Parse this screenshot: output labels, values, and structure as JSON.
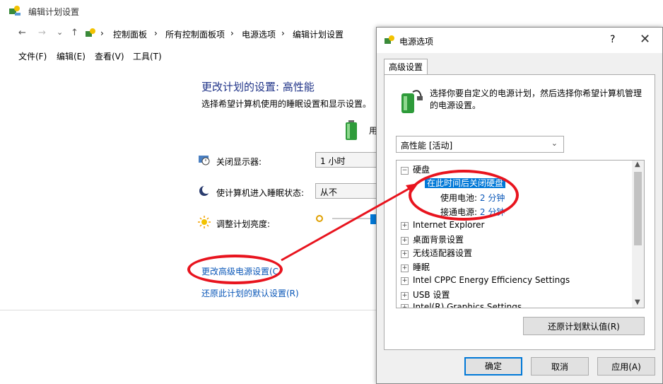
{
  "window": {
    "title": "编辑计划设置",
    "nav": {
      "back": "←",
      "forward": "→",
      "dropdown": "⌄",
      "up": "↑"
    },
    "breadcrumb": [
      "控制面板",
      "所有控制面板项",
      "电源选项",
      "编辑计划设置"
    ],
    "breadcrumb_sep": "›",
    "menu": [
      "文件(F)",
      "编辑(E)",
      "查看(V)",
      "工具(T)"
    ]
  },
  "plan": {
    "headline": "更改计划的设置: 高性能",
    "subline": "选择希望计算机使用的睡眠设置和显示设置。",
    "battery_label": "用",
    "settings": [
      {
        "label": "关闭显示器:",
        "value": "1 小时"
      },
      {
        "label": "使计算机进入睡眠状态:",
        "value": "从不"
      },
      {
        "label": "调整计划亮度:",
        "value": ""
      }
    ],
    "link_advanced": "更改高级电源设置(C",
    "link_restore": "还原此计划的默认设置(R)"
  },
  "dialog": {
    "title": "电源选项",
    "help": "?",
    "close": "✕",
    "tab": "高级设置",
    "description": "选择你要自定义的电源计划，然后选择你希望计算机管理的电源设置。",
    "plan_selected": "高性能 [活动]",
    "tree": {
      "harddisk": "硬盘",
      "turnoff_after": "在此时间后关闭硬盘",
      "on_battery_label": "使用电池:",
      "on_battery_value": "2 分钟",
      "plugged_label": "接通电源:",
      "plugged_value": "2 分钟",
      "items": [
        "Internet Explorer",
        "桌面背景设置",
        "无线适配器设置",
        "睡眠",
        "Intel CPPC Energy Efficiency Settings",
        "USB 设置",
        "Intel(R) Graphics Settings"
      ]
    },
    "restore_button": "还原计划默认值(R)",
    "ok": "确定",
    "cancel": "取消",
    "apply": "应用(A)"
  },
  "colors": {
    "accent": "#0078d7",
    "annotation_red": "#e8141e",
    "link": "#0a57b8"
  }
}
